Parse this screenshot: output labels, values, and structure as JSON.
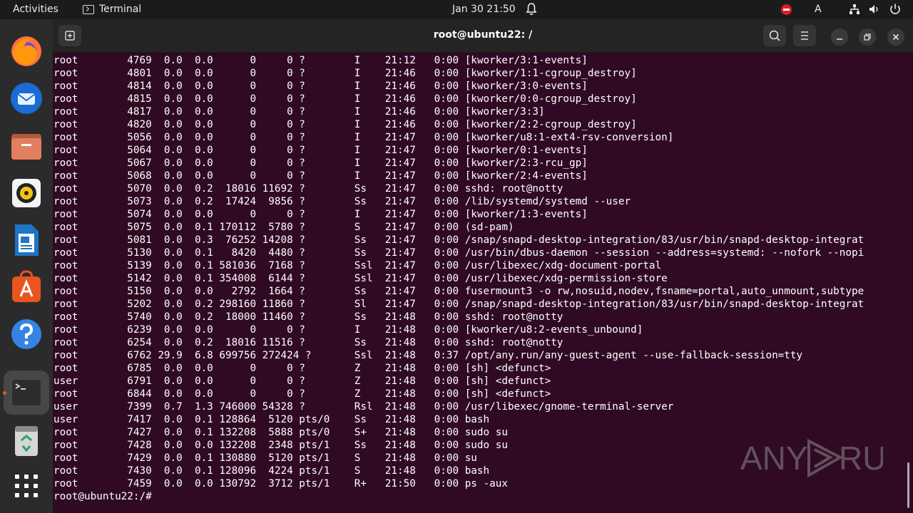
{
  "topbar": {
    "activities": "Activities",
    "app_name": "Terminal",
    "clock": "Jan 30  21:50",
    "keyboard_layout": "A"
  },
  "dock": {
    "items": [
      "firefox-icon",
      "thunderbird-icon",
      "files-icon",
      "rhythmbox-icon",
      "writer-icon",
      "app-center-icon",
      "help-icon",
      "terminal-icon",
      "trash-icon",
      "show-apps-icon"
    ]
  },
  "window": {
    "title": "root@ubuntu22: /"
  },
  "terminal": {
    "lines": [
      "root        4769  0.0  0.0      0     0 ?        I    21:12   0:00 [kworker/3:1-events]",
      "root        4801  0.0  0.0      0     0 ?        I    21:46   0:00 [kworker/1:1-cgroup_destroy]",
      "root        4814  0.0  0.0      0     0 ?        I    21:46   0:00 [kworker/3:0-events]",
      "root        4815  0.0  0.0      0     0 ?        I    21:46   0:00 [kworker/0:0-cgroup_destroy]",
      "root        4817  0.0  0.0      0     0 ?        I    21:46   0:00 [kworker/3:3]",
      "root        4820  0.0  0.0      0     0 ?        I    21:46   0:00 [kworker/2:2-cgroup_destroy]",
      "root        5056  0.0  0.0      0     0 ?        I    21:47   0:00 [kworker/u8:1-ext4-rsv-conversion]",
      "root        5064  0.0  0.0      0     0 ?        I    21:47   0:00 [kworker/0:1-events]",
      "root        5067  0.0  0.0      0     0 ?        I    21:47   0:00 [kworker/2:3-rcu_gp]",
      "root        5068  0.0  0.0      0     0 ?        I    21:47   0:00 [kworker/2:4-events]",
      "root        5070  0.0  0.2  18016 11692 ?        Ss   21:47   0:00 sshd: root@notty",
      "root        5073  0.0  0.2  17424  9856 ?        Ss   21:47   0:00 /lib/systemd/systemd --user",
      "root        5074  0.0  0.0      0     0 ?        I    21:47   0:00 [kworker/1:3-events]",
      "root        5075  0.0  0.1 170112  5780 ?        S    21:47   0:00 (sd-pam)",
      "root        5081  0.0  0.3  76252 14208 ?        Ss   21:47   0:00 /snap/snapd-desktop-integration/83/usr/bin/snapd-desktop-integrat",
      "root        5130  0.0  0.1   8420  4480 ?        Ss   21:47   0:00 /usr/bin/dbus-daemon --session --address=systemd: --nofork --nopi",
      "root        5139  0.0  0.1 581036  7168 ?        Ssl  21:47   0:00 /usr/libexec/xdg-document-portal",
      "root        5142  0.0  0.1 354008  6144 ?        Ssl  21:47   0:00 /usr/libexec/xdg-permission-store",
      "root        5150  0.0  0.0   2792  1664 ?        Ss   21:47   0:00 fusermount3 -o rw,nosuid,nodev,fsname=portal,auto_unmount,subtype",
      "root        5202  0.0  0.2 298160 11860 ?        Sl   21:47   0:00 /snap/snapd-desktop-integration/83/usr/bin/snapd-desktop-integrat",
      "root        5740  0.0  0.2  18000 11460 ?        Ss   21:48   0:00 sshd: root@notty",
      "root        6239  0.0  0.0      0     0 ?        I    21:48   0:00 [kworker/u8:2-events_unbound]",
      "root        6254  0.0  0.2  18016 11516 ?        Ss   21:48   0:00 sshd: root@notty",
      "root        6762 29.9  6.8 699756 272424 ?       Ssl  21:48   0:37 /opt/any.run/any-guest-agent --use-fallback-session=tty",
      "root        6785  0.0  0.0      0     0 ?        Z    21:48   0:00 [sh] <defunct>",
      "user        6791  0.0  0.0      0     0 ?        Z    21:48   0:00 [sh] <defunct>",
      "root        6844  0.0  0.0      0     0 ?        Z    21:48   0:00 [sh] <defunct>",
      "user        7399  0.7  1.3 746000 54328 ?        Rsl  21:48   0:00 /usr/libexec/gnome-terminal-server",
      "user        7417  0.0  0.1 128864  5120 pts/0    Ss   21:48   0:00 bash",
      "root        7427  0.0  0.1 132208  5888 pts/0    S+   21:48   0:00 sudo su",
      "root        7428  0.0  0.0 132208  2348 pts/1    Ss   21:48   0:00 sudo su",
      "root        7429  0.0  0.1 130880  5120 pts/1    S    21:48   0:00 su",
      "root        7430  0.0  0.1 128096  4224 pts/1    S    21:48   0:00 bash",
      "root        7459  0.0  0.0 130792  3712 pts/1    R+   21:50   0:00 ps -aux",
      "root@ubuntu22:/# "
    ]
  },
  "watermark": {
    "text_left": "ANY",
    "text_right": "RUN"
  },
  "colors": {
    "terminal_bg": "#300a24",
    "accent": "#e95420",
    "headerbar": "#242424"
  }
}
